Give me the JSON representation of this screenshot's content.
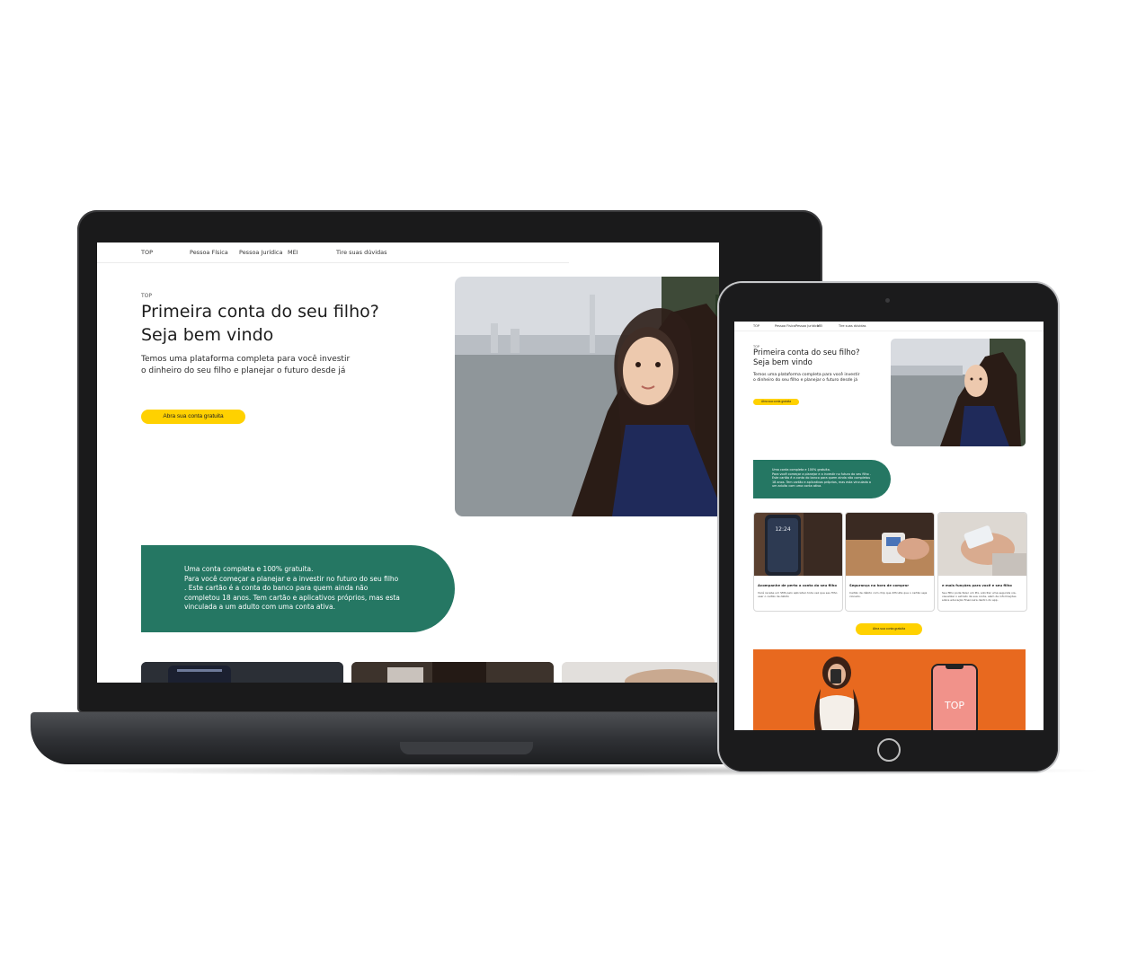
{
  "nav": {
    "brand": "TOP",
    "items": [
      "Pessoa Física",
      "Pessoa Jurídica",
      "MEI"
    ],
    "help": "Tire suas dúvidas"
  },
  "hero": {
    "kicker": "TOP",
    "title_line1": "Primeira conta do seu filho?",
    "title_line2": "Seja bem vindo",
    "subtitle_line1": "Temos uma plataforma completa para você investir",
    "subtitle_line2": "o dinheiro do seu filho e planejar o futuro desde já",
    "cta": "Abra sua conta gratuita"
  },
  "info": {
    "line1": "Uma conta completa e 100% gratuita.",
    "body": "Para você começar a planejar e a investir no futuro do seu filho . Este cartão é a conta do banco para quem ainda não completou 18 anos. Tem cartão e aplicativos próprios, mas esta vinculada a um adulto com uma conta ativa."
  },
  "cards": [
    {
      "title": "Acompanhe de perto a conta do seu filho",
      "desc": "Você recebe um SMS pelo aplicativo toda vez que seu filho usar o cartão de débito"
    },
    {
      "title": "Segurança na hora de comprar",
      "desc": "Cartão de débito com chip que dificulta que o cartão seja clonado."
    },
    {
      "title": "e mais funções para você e seu filho",
      "desc": "Seu filho pode fazer um Pix, solicitar uma segunda via, visualizar o extrato da sua conta, além de informações sobre educação financeira dentro do app."
    }
  ],
  "cta2": "Abra sua conta gratuita",
  "promo": {
    "phone_label": "TOP"
  },
  "phone_clock": "12:24",
  "colors": {
    "accent_green": "#257763",
    "accent_yellow": "#ffd100",
    "promo_orange": "#e8691f"
  }
}
